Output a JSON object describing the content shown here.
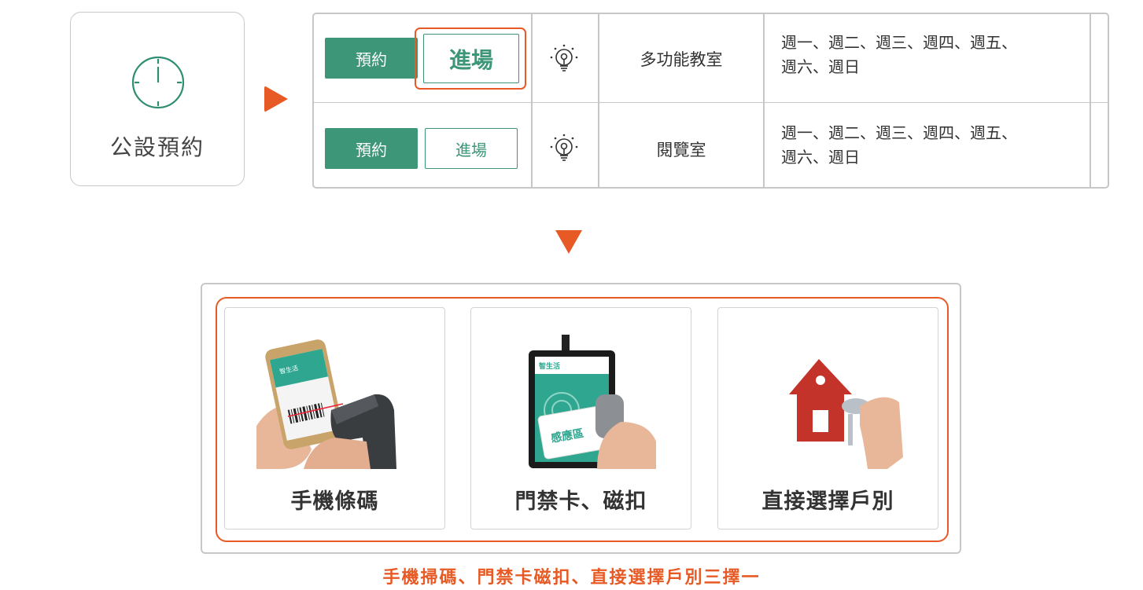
{
  "facility_card": {
    "label": "公設預約",
    "icon": "clock-icon"
  },
  "table": {
    "rows": [
      {
        "book_label": "預約",
        "enter_label": "進場",
        "icon": "lightbulb-icon",
        "room": "多功能教室",
        "days_line1": "週一、週二、週三、週四、週五、",
        "days_line2": "週六、週日"
      },
      {
        "book_label": "預約",
        "enter_label": "進場",
        "icon": "lightbulb-icon",
        "room": "閱覽室",
        "days_line1": "週一、週二、週三、週四、週五、",
        "days_line2": "週六、週日"
      }
    ]
  },
  "methods": [
    {
      "label": "手機條碼",
      "icon": "phone-barcode-scan-icon",
      "phone_text": "智生活"
    },
    {
      "label": "門禁卡、磁扣",
      "icon": "card-reader-icon",
      "reader_brand": "智生活",
      "reader_zone": "感應區"
    },
    {
      "label": "直接選擇戶別",
      "icon": "house-key-icon"
    }
  ],
  "caption": "手機掃碼、門禁卡磁扣、直接選擇戶別三擇一",
  "colors": {
    "accent": "#e85a25",
    "brand_green": "#3e9678",
    "teal": "#2fa690"
  }
}
